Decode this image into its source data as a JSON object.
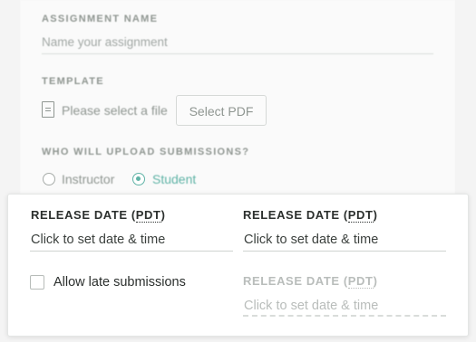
{
  "form": {
    "assignment_name": {
      "label": "ASSIGNMENT NAME",
      "placeholder": "Name your assignment"
    },
    "template": {
      "label": "TEMPLATE",
      "file_status": "Please select a file",
      "button_label": "Select PDF"
    },
    "uploaders": {
      "label": "WHO WILL UPLOAD SUBMISSIONS?",
      "options": [
        {
          "label": "Instructor",
          "selected": false
        },
        {
          "label": "Student",
          "selected": true
        }
      ]
    }
  },
  "dates_panel": {
    "release": {
      "label_prefix": "RELEASE DATE (",
      "label_tz": "PDT",
      "label_suffix": ")",
      "placeholder": "Click to set date & time"
    },
    "due": {
      "label_prefix": "RELEASE DATE (",
      "label_tz": "PDT",
      "label_suffix": ")",
      "placeholder": "Click to set date & time"
    },
    "late": {
      "checkbox_label": "Allow late submissions",
      "checked": false
    },
    "late_due": {
      "label_prefix": "RELEASE DATE (",
      "label_tz": "PDT",
      "label_suffix": ")",
      "placeholder": "Click to set date & time",
      "disabled": true
    }
  },
  "colors": {
    "accent": "#5fb3a6",
    "muted": "#8f9691",
    "text": "#2b2f2d"
  },
  "icons": {
    "template_file": "file-icon"
  }
}
